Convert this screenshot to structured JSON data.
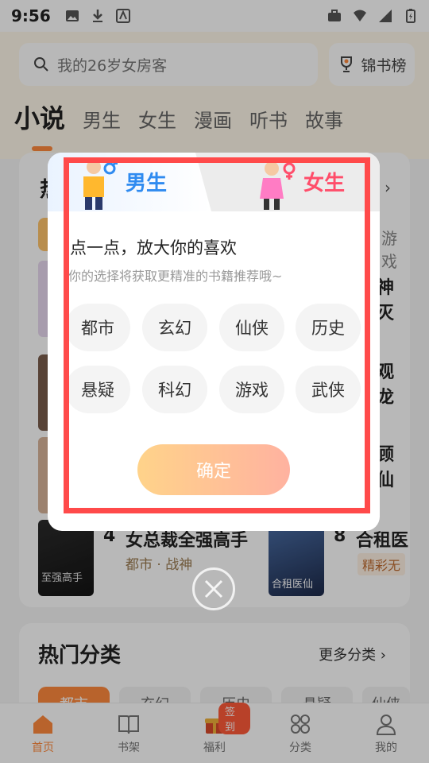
{
  "status_bar": {
    "time": "9:56"
  },
  "search": {
    "placeholder": "我的26岁女房客"
  },
  "rank_button": {
    "label": "锦书榜"
  },
  "tabs": [
    {
      "label": "小说"
    },
    {
      "label": "男生"
    },
    {
      "label": "女生"
    },
    {
      "label": "漫画"
    },
    {
      "label": "听书"
    },
    {
      "label": "故事"
    }
  ],
  "background_card": {
    "title_partial": "热",
    "books": [
      {
        "rank": "4",
        "title": "女总裁全强高手",
        "meta": "都市 · 战神",
        "cover_text": "至强高手"
      },
      {
        "rank": "8",
        "title": "合租医",
        "meta": "精彩无",
        "cover_text": "合租医仙"
      }
    ],
    "right_fragments": [
      "游戏",
      "神灭",
      "观龙",
      "顾仙"
    ]
  },
  "hot_categories": {
    "title": "热门分类",
    "more": "更多分类",
    "chips": [
      "都市",
      "玄幻",
      "历史",
      "悬疑",
      "仙侠"
    ]
  },
  "bottom_nav": [
    {
      "label": "首页",
      "active": true
    },
    {
      "label": "书架",
      "active": false
    },
    {
      "label": "福利",
      "active": false,
      "badge": "签到"
    },
    {
      "label": "分类",
      "active": false
    },
    {
      "label": "我的",
      "active": false
    }
  ],
  "dialog": {
    "male_label": "男生",
    "female_label": "女生",
    "title": "点一点，放大你的喜欢",
    "subtitle": "你的选择将获取更精准的书籍推荐哦~",
    "genres": [
      "都市",
      "玄幻",
      "仙侠",
      "历史",
      "悬疑",
      "科幻",
      "游戏",
      "武侠"
    ],
    "confirm_label": "确定"
  },
  "colors": {
    "accent": "#ff8a3d",
    "male": "#2f8bf0",
    "female": "#ff4d6a",
    "highlight_frame": "#ff4a4a"
  }
}
